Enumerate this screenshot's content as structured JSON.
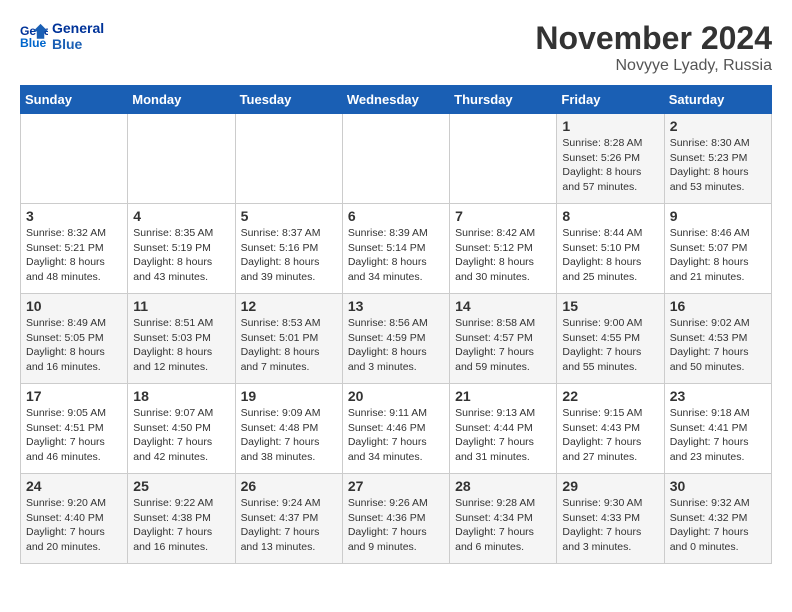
{
  "header": {
    "logo_line1": "General",
    "logo_line2": "Blue",
    "month": "November 2024",
    "location": "Novyye Lyady, Russia"
  },
  "days_of_week": [
    "Sunday",
    "Monday",
    "Tuesday",
    "Wednesday",
    "Thursday",
    "Friday",
    "Saturday"
  ],
  "weeks": [
    [
      {
        "day": "",
        "info": ""
      },
      {
        "day": "",
        "info": ""
      },
      {
        "day": "",
        "info": ""
      },
      {
        "day": "",
        "info": ""
      },
      {
        "day": "",
        "info": ""
      },
      {
        "day": "1",
        "info": "Sunrise: 8:28 AM\nSunset: 5:26 PM\nDaylight: 8 hours\nand 57 minutes."
      },
      {
        "day": "2",
        "info": "Sunrise: 8:30 AM\nSunset: 5:23 PM\nDaylight: 8 hours\nand 53 minutes."
      }
    ],
    [
      {
        "day": "3",
        "info": "Sunrise: 8:32 AM\nSunset: 5:21 PM\nDaylight: 8 hours\nand 48 minutes."
      },
      {
        "day": "4",
        "info": "Sunrise: 8:35 AM\nSunset: 5:19 PM\nDaylight: 8 hours\nand 43 minutes."
      },
      {
        "day": "5",
        "info": "Sunrise: 8:37 AM\nSunset: 5:16 PM\nDaylight: 8 hours\nand 39 minutes."
      },
      {
        "day": "6",
        "info": "Sunrise: 8:39 AM\nSunset: 5:14 PM\nDaylight: 8 hours\nand 34 minutes."
      },
      {
        "day": "7",
        "info": "Sunrise: 8:42 AM\nSunset: 5:12 PM\nDaylight: 8 hours\nand 30 minutes."
      },
      {
        "day": "8",
        "info": "Sunrise: 8:44 AM\nSunset: 5:10 PM\nDaylight: 8 hours\nand 25 minutes."
      },
      {
        "day": "9",
        "info": "Sunrise: 8:46 AM\nSunset: 5:07 PM\nDaylight: 8 hours\nand 21 minutes."
      }
    ],
    [
      {
        "day": "10",
        "info": "Sunrise: 8:49 AM\nSunset: 5:05 PM\nDaylight: 8 hours\nand 16 minutes."
      },
      {
        "day": "11",
        "info": "Sunrise: 8:51 AM\nSunset: 5:03 PM\nDaylight: 8 hours\nand 12 minutes."
      },
      {
        "day": "12",
        "info": "Sunrise: 8:53 AM\nSunset: 5:01 PM\nDaylight: 8 hours\nand 7 minutes."
      },
      {
        "day": "13",
        "info": "Sunrise: 8:56 AM\nSunset: 4:59 PM\nDaylight: 8 hours\nand 3 minutes."
      },
      {
        "day": "14",
        "info": "Sunrise: 8:58 AM\nSunset: 4:57 PM\nDaylight: 7 hours\nand 59 minutes."
      },
      {
        "day": "15",
        "info": "Sunrise: 9:00 AM\nSunset: 4:55 PM\nDaylight: 7 hours\nand 55 minutes."
      },
      {
        "day": "16",
        "info": "Sunrise: 9:02 AM\nSunset: 4:53 PM\nDaylight: 7 hours\nand 50 minutes."
      }
    ],
    [
      {
        "day": "17",
        "info": "Sunrise: 9:05 AM\nSunset: 4:51 PM\nDaylight: 7 hours\nand 46 minutes."
      },
      {
        "day": "18",
        "info": "Sunrise: 9:07 AM\nSunset: 4:50 PM\nDaylight: 7 hours\nand 42 minutes."
      },
      {
        "day": "19",
        "info": "Sunrise: 9:09 AM\nSunset: 4:48 PM\nDaylight: 7 hours\nand 38 minutes."
      },
      {
        "day": "20",
        "info": "Sunrise: 9:11 AM\nSunset: 4:46 PM\nDaylight: 7 hours\nand 34 minutes."
      },
      {
        "day": "21",
        "info": "Sunrise: 9:13 AM\nSunset: 4:44 PM\nDaylight: 7 hours\nand 31 minutes."
      },
      {
        "day": "22",
        "info": "Sunrise: 9:15 AM\nSunset: 4:43 PM\nDaylight: 7 hours\nand 27 minutes."
      },
      {
        "day": "23",
        "info": "Sunrise: 9:18 AM\nSunset: 4:41 PM\nDaylight: 7 hours\nand 23 minutes."
      }
    ],
    [
      {
        "day": "24",
        "info": "Sunrise: 9:20 AM\nSunset: 4:40 PM\nDaylight: 7 hours\nand 20 minutes."
      },
      {
        "day": "25",
        "info": "Sunrise: 9:22 AM\nSunset: 4:38 PM\nDaylight: 7 hours\nand 16 minutes."
      },
      {
        "day": "26",
        "info": "Sunrise: 9:24 AM\nSunset: 4:37 PM\nDaylight: 7 hours\nand 13 minutes."
      },
      {
        "day": "27",
        "info": "Sunrise: 9:26 AM\nSunset: 4:36 PM\nDaylight: 7 hours\nand 9 minutes."
      },
      {
        "day": "28",
        "info": "Sunrise: 9:28 AM\nSunset: 4:34 PM\nDaylight: 7 hours\nand 6 minutes."
      },
      {
        "day": "29",
        "info": "Sunrise: 9:30 AM\nSunset: 4:33 PM\nDaylight: 7 hours\nand 3 minutes."
      },
      {
        "day": "30",
        "info": "Sunrise: 9:32 AM\nSunset: 4:32 PM\nDaylight: 7 hours\nand 0 minutes."
      }
    ]
  ]
}
